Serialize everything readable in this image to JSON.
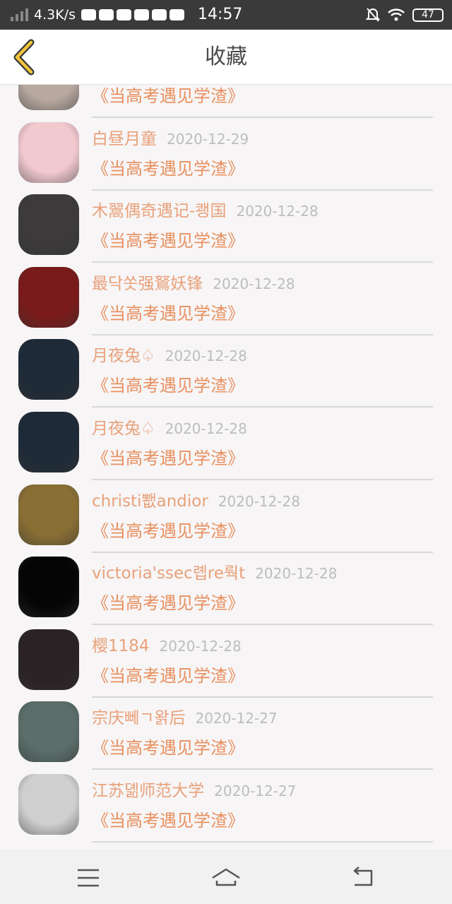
{
  "status_bar": {
    "speed": "4.3K/s",
    "time": "14:57",
    "battery": "47",
    "icons": [
      "signal-icon",
      "cat-icon",
      "wechat-icon",
      "cloud-icon",
      "mail-icon",
      "browser-icon",
      "crown-icon",
      "mute-bell-icon",
      "wifi-icon"
    ]
  },
  "header": {
    "title": "收藏",
    "back_icon": "chevron-left-icon"
  },
  "favorites": [
    {
      "name": "",
      "date": "",
      "book": "《当高考遇见学渣》",
      "avatar_color": "#b8a9a0"
    },
    {
      "name": "白昼月童",
      "date": "2020-12-29",
      "book": "《当高考遇见学渣》",
      "avatar_color": "#f1c9cf"
    },
    {
      "name": "木翯偶奇遇记-쾡国",
      "date": "2020-12-28",
      "book": "《当高考遇见学渣》",
      "avatar_color": "#3c3a3a"
    },
    {
      "name": "最닥쏫强鴑妖锋",
      "date": "2020-12-28",
      "book": "《当高考遇见学渣》",
      "avatar_color": "#7a1a1a"
    },
    {
      "name": "月夜兔♤",
      "date": "2020-12-28",
      "book": "《当高考遇见学渣》",
      "avatar_color": "#1e2a38"
    },
    {
      "name": "月夜兔♤",
      "date": "2020-12-28",
      "book": "《当高考遇见学渣》",
      "avatar_color": "#1e2a38"
    },
    {
      "name": "christi뾊andior",
      "date": "2020-12-28",
      "book": "《当高考遇见学渣》",
      "avatar_color": "#8a6f35"
    },
    {
      "name": "victoria'ssec롑re뤅t",
      "date": "2020-12-28",
      "book": "《当高考遇见学渣》",
      "avatar_color": "#050505"
    },
    {
      "name": "樱1184",
      "date": "2020-12-28",
      "book": "《当高考遇见学渣》",
      "avatar_color": "#2a2224"
    },
    {
      "name": "宗庆뻬ㄱ왉后",
      "date": "2020-12-27",
      "book": "《当高考遇见学渣》",
      "avatar_color": "#5b6e6a"
    },
    {
      "name": "江苏뎲师范大学",
      "date": "2020-12-27",
      "book": "《当高考遇见学渣》",
      "avatar_color": "#cfcfcf"
    }
  ],
  "bottom_nav": {
    "items": [
      "menu-icon",
      "home-icon",
      "back-arrow-icon"
    ]
  }
}
